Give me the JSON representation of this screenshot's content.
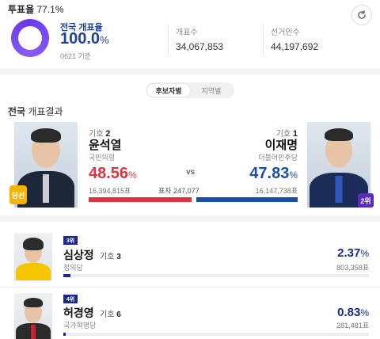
{
  "header": {
    "turnout_label": "투표율",
    "turnout_value": "77.1%"
  },
  "count": {
    "label": "전국 개표율",
    "value": "100.0",
    "unit": "%",
    "time": "0621 기준",
    "progress": 100.0
  },
  "stats": {
    "counted_label": "개표수",
    "counted_value": "34,067,853",
    "electors_label": "선거인수",
    "electors_value": "44,197,692"
  },
  "tabs": [
    {
      "label": "후보자별",
      "active": true
    },
    {
      "label": "지역별",
      "active": false
    }
  ],
  "section": {
    "title_bold": "전국",
    "title_rest": " 개표결과"
  },
  "left_candidate": {
    "number_label": "기호",
    "number": "2",
    "name": "윤석열",
    "party": "국민의힘",
    "pct": "48.56",
    "pct_unit": "%",
    "votes": "16,394,815표",
    "badge": "당선",
    "bar_share": 48.56
  },
  "right_candidate": {
    "number_label": "기호",
    "number": "1",
    "name": "이재명",
    "party": "더불어민주당",
    "pct": "47.83",
    "pct_unit": "%",
    "votes": "16,147,738표",
    "badge": "2위",
    "bar_share": 47.83
  },
  "vs_label": "vs",
  "margin_label": "표차 247,077",
  "minor_candidates": [
    {
      "rank": "3위",
      "name": "심상정",
      "number_label": "기호",
      "number": "3",
      "party": "정의당",
      "pct": "2.37",
      "pct_unit": "%",
      "votes": "803,358표",
      "share": 2.37
    },
    {
      "rank": "4위",
      "name": "허경영",
      "number_label": "기호",
      "number": "6",
      "party": "국가혁명당",
      "pct": "0.83",
      "pct_unit": "%",
      "votes": "281,481표",
      "share": 0.83
    }
  ],
  "colors": {
    "red": "#e03340",
    "blue": "#1a4fa8",
    "navy": "#1a2a86",
    "winner_badge": "#f5b400",
    "second_badge": "#5b2bbf"
  }
}
